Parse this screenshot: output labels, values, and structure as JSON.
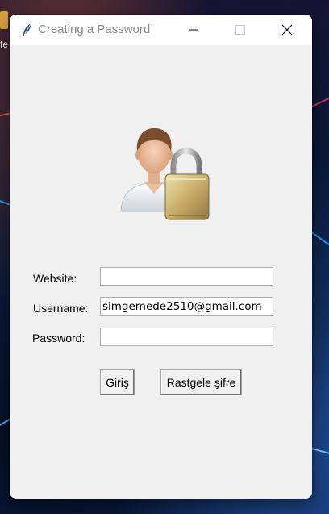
{
  "desktop": {
    "label_fragment": "fe"
  },
  "window": {
    "title": "Creating a Password",
    "icons": {
      "app": "feather-icon",
      "minimize": "minimize-icon",
      "maximize": "maximize-icon",
      "close": "close-icon"
    },
    "hero_image": "user-with-padlock-icon"
  },
  "form": {
    "website": {
      "label": "Website:",
      "value": ""
    },
    "username": {
      "label": "Username:",
      "value": "simgemede2510@gmail.com"
    },
    "password": {
      "label": "Password:",
      "value": ""
    }
  },
  "buttons": {
    "login": "Giriş",
    "random_password": "Rastgele şifre"
  },
  "colors": {
    "window_bg": "#f0f0f0",
    "titlebar_bg": "#ffffff",
    "title_text": "#8a8a8a"
  }
}
